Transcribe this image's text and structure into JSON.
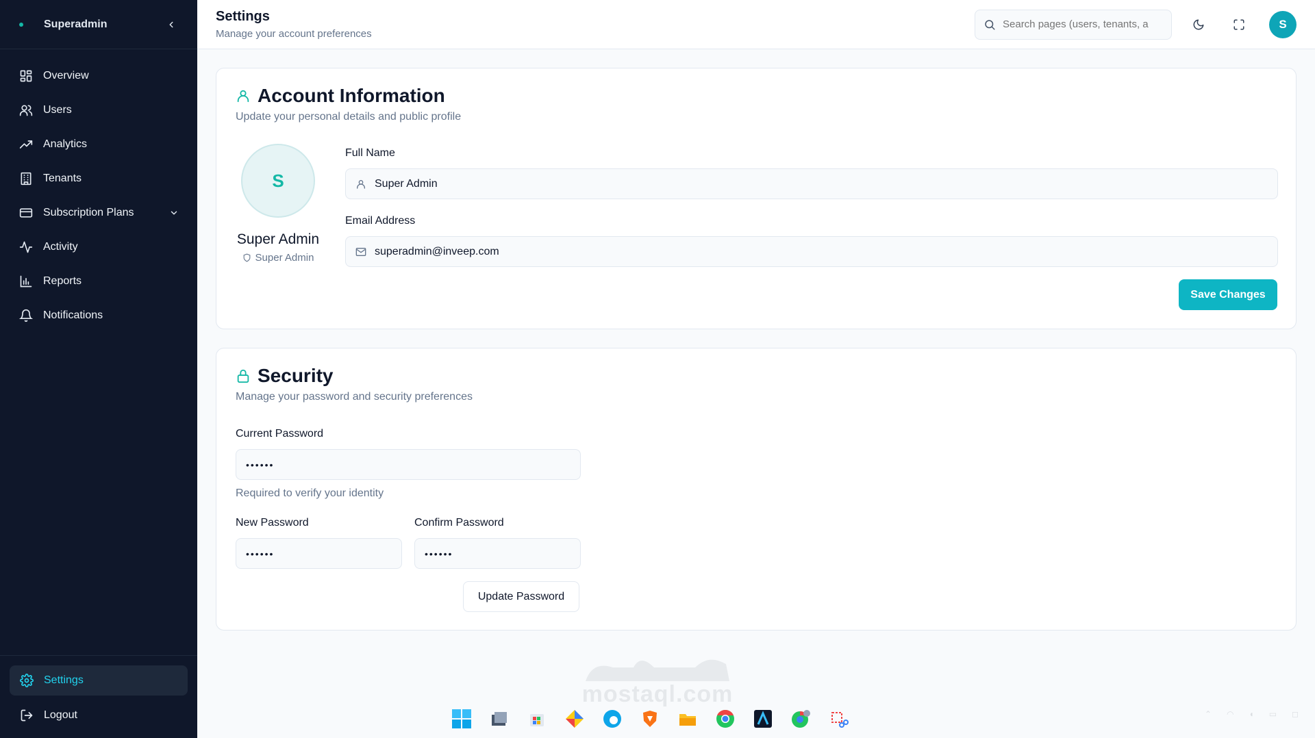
{
  "sidebar": {
    "brand": "Superadmin",
    "items": [
      {
        "label": "Overview",
        "icon": "grid-icon"
      },
      {
        "label": "Users",
        "icon": "users-icon"
      },
      {
        "label": "Analytics",
        "icon": "trending-up-icon"
      },
      {
        "label": "Tenants",
        "icon": "building-icon"
      },
      {
        "label": "Subscription Plans",
        "icon": "credit-card-icon"
      },
      {
        "label": "Activity",
        "icon": "activity-icon"
      },
      {
        "label": "Reports",
        "icon": "bar-chart-icon"
      },
      {
        "label": "Notifications",
        "icon": "bell-icon"
      }
    ],
    "settings_label": "Settings",
    "logout_label": "Logout"
  },
  "header": {
    "title": "Settings",
    "subtitle": "Manage your account preferences",
    "search_placeholder": "Search pages (users, tenants, a",
    "avatar_initial": "S"
  },
  "account": {
    "title": "Account Information",
    "description": "Update your personal details and public profile",
    "avatar_initial": "S",
    "name": "Super Admin",
    "role": "Super Admin",
    "full_name_label": "Full Name",
    "full_name_value": "Super Admin",
    "email_label": "Email Address",
    "email_value": "superadmin@inveep.com",
    "save_label": "Save Changes"
  },
  "security": {
    "title": "Security",
    "description": "Manage your password and security preferences",
    "current_label": "Current Password",
    "current_value": "••••••",
    "current_hint": "Required to verify your identity",
    "new_label": "New Password",
    "new_value": "••••••",
    "confirm_label": "Confirm Password",
    "confirm_value": "••••••",
    "update_label": "Update Password"
  },
  "watermark": {
    "text": "mostaql.com"
  },
  "colors": {
    "sidebar_bg": "#0f172a",
    "accent": "#0eb5c4",
    "page_bg": "#f8fafc"
  }
}
